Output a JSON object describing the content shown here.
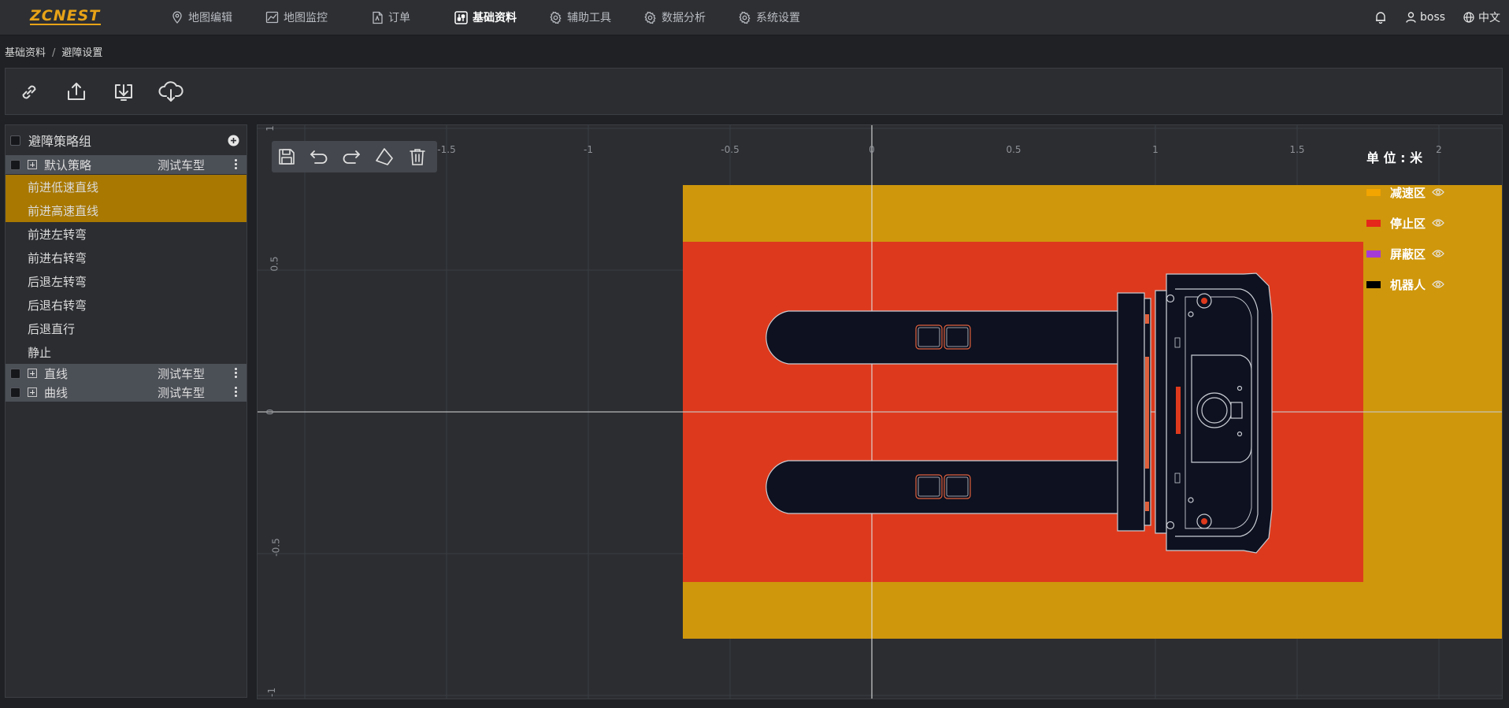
{
  "app": {
    "logo": "ZCNEST"
  },
  "nav": {
    "items": [
      {
        "label": "地图编辑",
        "icon": "map-pin-icon"
      },
      {
        "label": "地图监控",
        "icon": "chart-line-icon"
      },
      {
        "label": "订单",
        "icon": "document-icon"
      },
      {
        "label": "基础资料",
        "icon": "sliders-icon",
        "active": true
      },
      {
        "label": "辅助工具",
        "icon": "gear-icon"
      },
      {
        "label": "数据分析",
        "icon": "gear-icon"
      },
      {
        "label": "系统设置",
        "icon": "gear-icon"
      }
    ],
    "user": "boss",
    "language": "中文"
  },
  "breadcrumb": {
    "root": "基础资料",
    "sep": "/",
    "current": "避障设置"
  },
  "toolbar": {
    "buttons": [
      "link-icon",
      "upload-icon",
      "download-icon",
      "cloud-download-icon"
    ]
  },
  "tree": {
    "header": "避障策略组",
    "groups": [
      {
        "label": "默认策略",
        "model": "测试车型",
        "expanded": true,
        "children": [
          {
            "label": "前进低速直线",
            "selected": true
          },
          {
            "label": "前进高速直线",
            "selected": true
          },
          {
            "label": "前进左转弯"
          },
          {
            "label": "前进右转弯"
          },
          {
            "label": "后退左转弯"
          },
          {
            "label": "后退右转弯"
          },
          {
            "label": "后退直行"
          },
          {
            "label": "静止"
          }
        ]
      },
      {
        "label": "直线",
        "model": "测试车型"
      },
      {
        "label": "曲线",
        "model": "测试车型"
      }
    ]
  },
  "editor": {
    "tools": [
      "save-icon",
      "undo-icon",
      "redo-icon",
      "polygon-icon",
      "delete-icon"
    ]
  },
  "plot": {
    "x_ticks": [
      "-1.5",
      "-1",
      "-0.5",
      "0",
      "0.5",
      "1",
      "1.5",
      "2"
    ],
    "y_ticks": [
      "1",
      "0.5",
      "0",
      "-0.5",
      "-1"
    ],
    "zones": {
      "slowdown": {
        "x": [
          -0.7,
          2.2
        ],
        "y": [
          0.8,
          -0.8
        ]
      },
      "stop": {
        "x": [
          -0.7,
          1.7
        ],
        "y": [
          0.6,
          -0.6
        ]
      }
    },
    "colors": {
      "slowdown": "#cf970c",
      "stop": "#dd3a1d",
      "shield": "#a43bd6",
      "robot": "#000000"
    }
  },
  "legend": {
    "unit": "单 位 : 米",
    "items": [
      {
        "label": "减速区",
        "color": "#f2a400"
      },
      {
        "label": "停止区",
        "color": "#e5261a"
      },
      {
        "label": "屏蔽区",
        "color": "#a43bd6"
      },
      {
        "label": "机器人",
        "color": "#000000"
      }
    ]
  }
}
